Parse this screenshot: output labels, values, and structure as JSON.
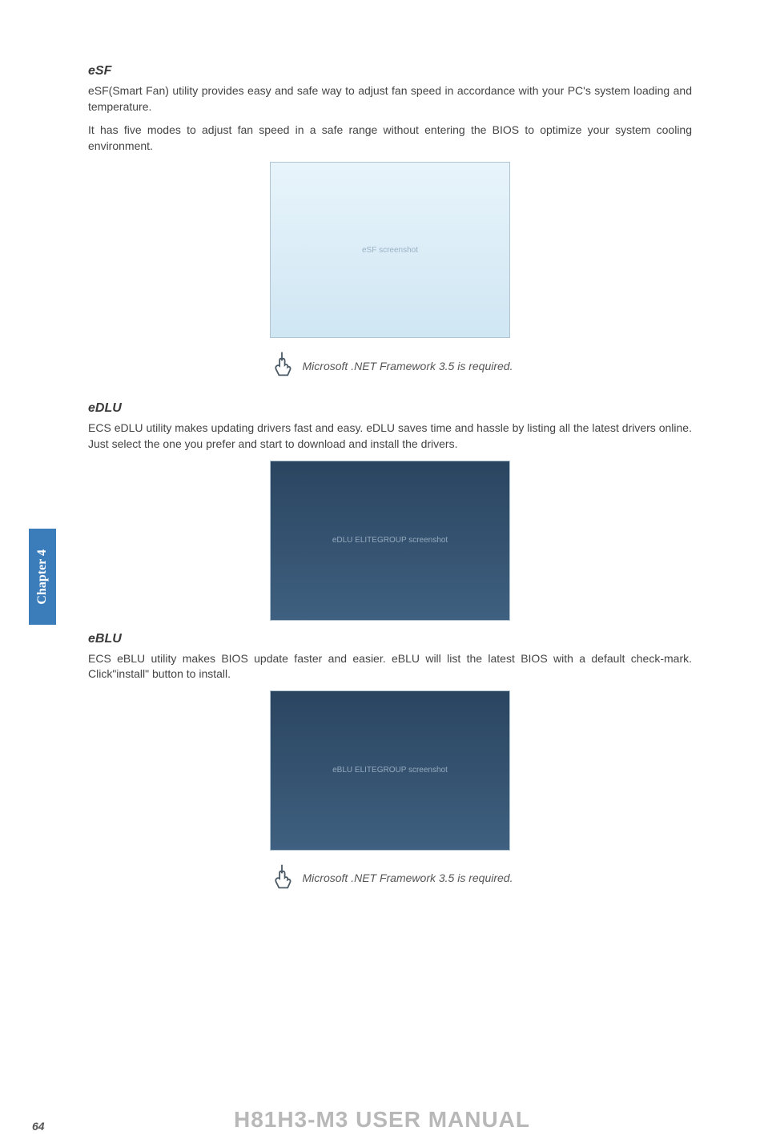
{
  "esf": {
    "title": "eSF",
    "p1": "eSF(Smart Fan) utility provides easy and safe way to adjust fan speed in accordance with your PC's system loading and temperature.",
    "p2": "It has five modes to adjust fan speed in a safe range without entering the BIOS to optimize your system cooling environment.",
    "note": "Microsoft .NET Framework 3.5 is required.",
    "shot_label": "eSF screenshot"
  },
  "edlu": {
    "title": "eDLU",
    "p1": "ECS eDLU utility makes updating drivers fast and easy. eDLU saves time and hassle by listing all the latest drivers online. Just select the one you prefer and start to download and install the drivers.",
    "shot_label": "eDLU ELITEGROUP screenshot"
  },
  "eblu": {
    "title": "eBLU",
    "p1": "ECS eBLU utility makes BIOS update faster and easier. eBLU will list the latest BIOS with a default check-mark. Click\"install\" button to install.",
    "note": "Microsoft .NET Framework 3.5 is required.",
    "shot_label": "eBLU ELITEGROUP screenshot"
  },
  "side_tab": "Chapter 4",
  "footer_title": "H81H3-M3 USER MANUAL",
  "page_number": "64"
}
